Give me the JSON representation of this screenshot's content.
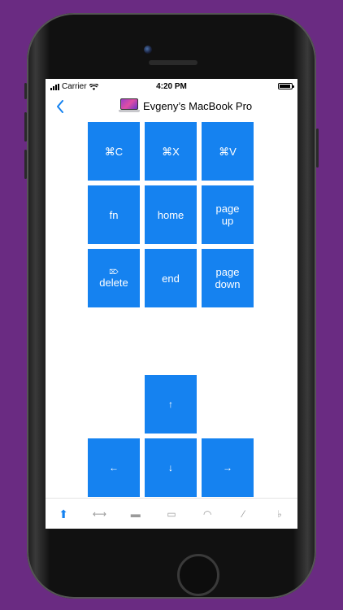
{
  "status_bar": {
    "carrier": "Carrier",
    "time": "4:20 PM"
  },
  "nav": {
    "back_icon": "chevron-left-icon",
    "title": "Evgeny’s MacBook Pro"
  },
  "keys": {
    "copy": "⌘C",
    "cut": "⌘X",
    "paste": "⌘V",
    "fn": "fn",
    "home": "home",
    "page_up": "page up",
    "delete_symbol": "⌦",
    "delete": "delete",
    "end": "end",
    "page_down": "page down",
    "up": "↑",
    "left": "←",
    "down": "↓",
    "right": "→"
  },
  "tabs": [
    {
      "icon": "arrow-up-icon",
      "glyph": "⬆",
      "active": true
    },
    {
      "icon": "swipe-icon",
      "glyph": "⟷",
      "active": false
    },
    {
      "icon": "keyboard-icon",
      "glyph": "▬",
      "active": false
    },
    {
      "icon": "media-icon",
      "glyph": "▭",
      "active": false
    },
    {
      "icon": "gauge-icon",
      "glyph": "◠",
      "active": false
    },
    {
      "icon": "tools-icon",
      "glyph": "⁄",
      "active": false
    },
    {
      "icon": "music-icon",
      "glyph": "♭",
      "active": false
    }
  ],
  "colors": {
    "key_blue": "#1582f0",
    "background_purple": "#6a2b82"
  }
}
